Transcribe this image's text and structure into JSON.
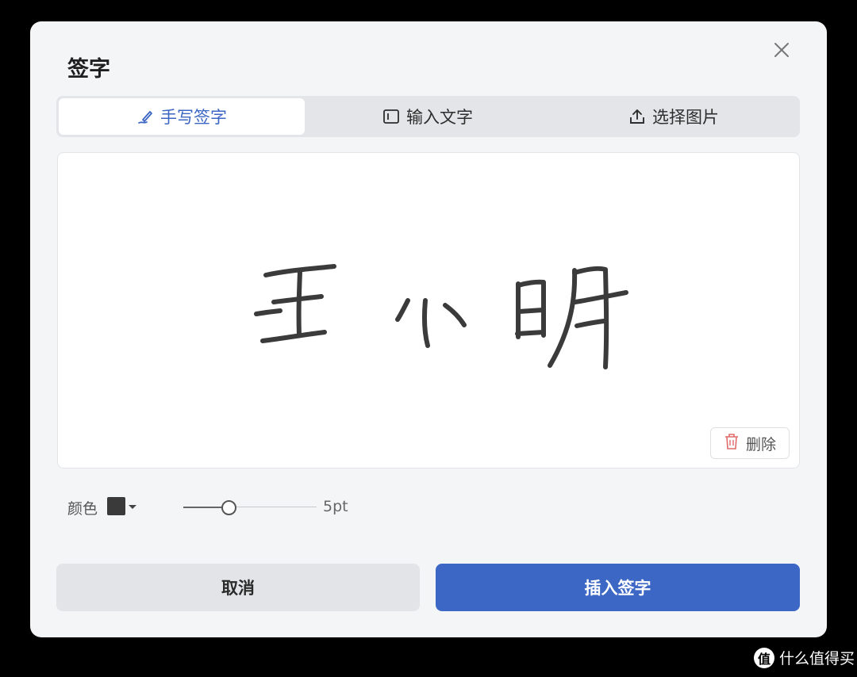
{
  "dialog": {
    "title": "签字",
    "close_icon": "close-icon"
  },
  "tabs": [
    {
      "label": "手写签字",
      "icon": "pen-icon",
      "active": true
    },
    {
      "label": "输入文字",
      "icon": "text-box-icon",
      "active": false
    },
    {
      "label": "选择图片",
      "icon": "upload-icon",
      "active": false
    }
  ],
  "canvas": {
    "signature_text": "王小明",
    "delete_label": "删除",
    "delete_icon": "trash-icon"
  },
  "toolbar": {
    "color_label": "颜色",
    "color_value": "#3a3a3a",
    "size_label": "5pt"
  },
  "actions": {
    "cancel_label": "取消",
    "insert_label": "插入签字",
    "accent_color": "#3c67c5"
  },
  "watermark": {
    "logo_text": "值",
    "text": "什么值得买"
  }
}
